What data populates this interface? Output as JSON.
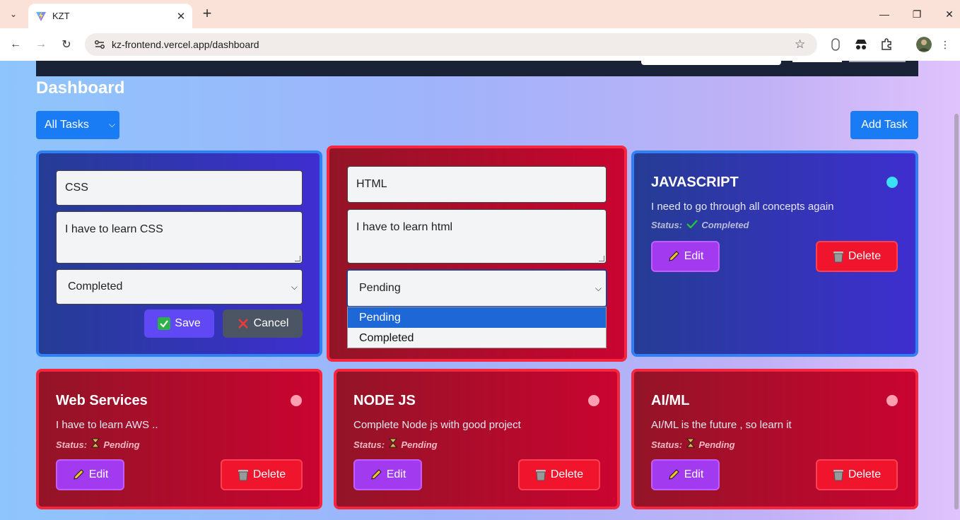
{
  "browser": {
    "tab_title": "KZT",
    "url": "kz-frontend.vercel.app/dashboard"
  },
  "page": {
    "title": "Dashboard",
    "filter_value": "All Tasks",
    "add_button": "Add Task"
  },
  "edit_cards": [
    {
      "title_value": "CSS",
      "description_value": "I have to learn CSS",
      "status_value": "Completed",
      "save_label": "Save",
      "cancel_label": "Cancel"
    },
    {
      "title_value": "HTML",
      "description_value": "I have to learn html",
      "status_value": "Pending",
      "options": [
        "Pending",
        "Completed"
      ]
    }
  ],
  "status_label": "Status:",
  "tasks": [
    {
      "title": "JAVASCRIPT",
      "description": "I need to go through all concepts again",
      "status": "Completed",
      "status_icon": "check-mark-icon"
    },
    {
      "title": "Web Services",
      "description": "I have to learn AWS ..",
      "status": "Pending",
      "status_icon": "hourglass-icon"
    },
    {
      "title": "NODE JS",
      "description": "Complete Node js with good project",
      "status": "Pending",
      "status_icon": "hourglass-icon"
    },
    {
      "title": "AI/ML",
      "description": "AI/ML is the future , so learn it",
      "status": "Pending",
      "status_icon": "hourglass-icon"
    }
  ],
  "edit_label": "Edit",
  "delete_label": "Delete",
  "colors": {
    "primary": "#1a7cf5",
    "completed_card": "#3f2ed0",
    "pending_card": "#c90430",
    "edit_button": "#a23af0",
    "delete_button": "#f0152d"
  }
}
